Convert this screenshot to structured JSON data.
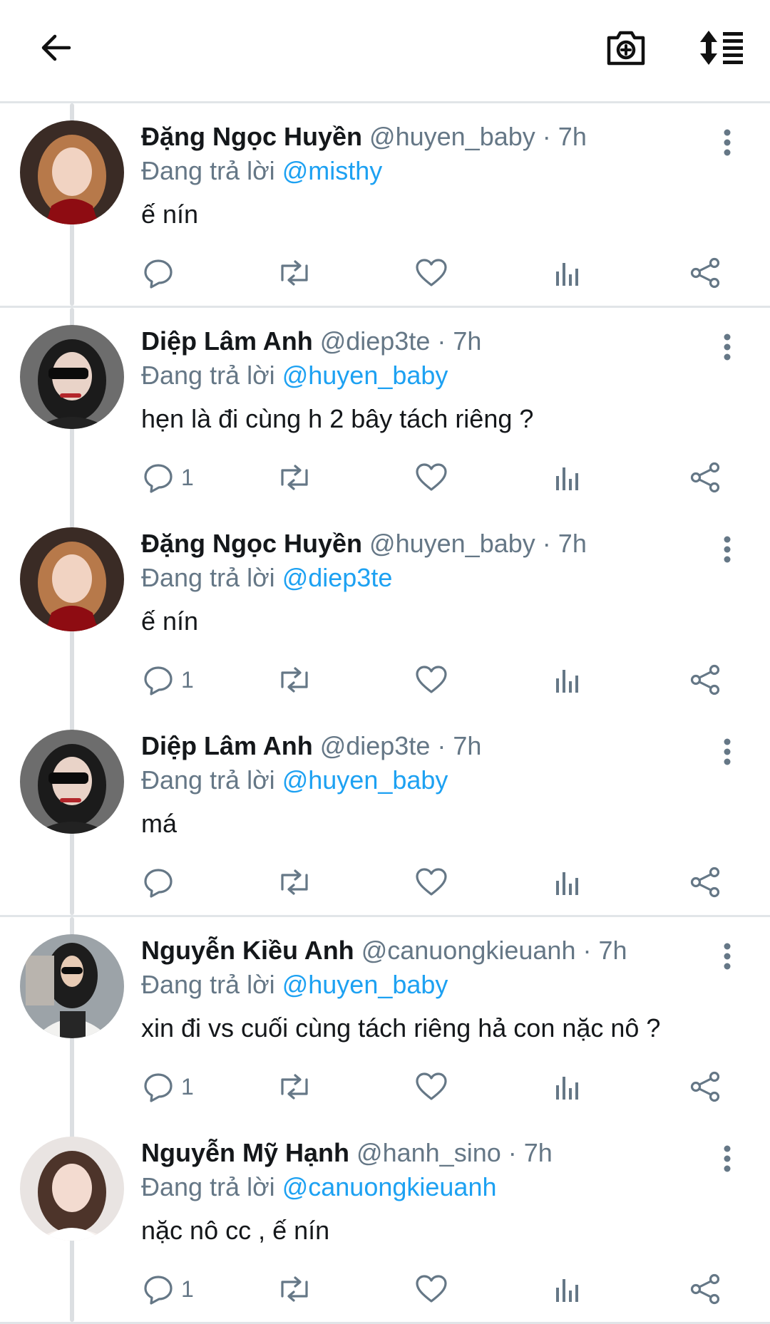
{
  "topbar": {
    "back_icon": "arrow-left-icon",
    "camera_icon": "camera-add-icon",
    "sort_icon": "sort-list-icon"
  },
  "colors": {
    "mention": "#1da1f2",
    "secondary_text": "#657786",
    "primary_text": "#14171a",
    "divider": "#e1e5e8",
    "thread_line": "#dcdfe2"
  },
  "reply_prefix": "Đang trả lời",
  "groups": [
    {
      "tweets": [
        {
          "name": "Đặng Ngọc Huyền",
          "handle": "@huyen_baby",
          "sep": "·",
          "time": "7h",
          "reply_to": "@misthy",
          "text": "ế nín",
          "reply_count": "",
          "avatar": "red-dress-woman"
        }
      ]
    },
    {
      "tweets": [
        {
          "name": "Diệp Lâm Anh",
          "handle": "@diep3te",
          "sep": "·",
          "time": "7h",
          "reply_to": "@huyen_baby",
          "text": "hẹn là đi cùng h 2 bây tách riêng ?",
          "reply_count": "1",
          "avatar": "sunglasses-woman"
        },
        {
          "name": "Đặng Ngọc Huyền",
          "handle": "@huyen_baby",
          "sep": "·",
          "time": "7h",
          "reply_to": "@diep3te",
          "text": "ế nín",
          "reply_count": "1",
          "avatar": "red-dress-woman"
        },
        {
          "name": "Diệp Lâm Anh",
          "handle": "@diep3te",
          "sep": "·",
          "time": "7h",
          "reply_to": "@huyen_baby",
          "text": "má",
          "reply_count": "",
          "avatar": "sunglasses-woman"
        }
      ]
    },
    {
      "tweets": [
        {
          "name": "Nguyễn Kiều Anh",
          "handle": "@canuongkieuanh",
          "sep": "·",
          "time": "7h",
          "reply_to": "@huyen_baby",
          "text": "xin đi vs cuối cùng tách riêng hả con nặc nô ?",
          "reply_count": "1",
          "avatar": "street-woman"
        },
        {
          "name": "Nguyễn Mỹ Hạnh",
          "handle": "@hanh_sino",
          "sep": "·",
          "time": "7h",
          "reply_to": "@canuongkieuanh",
          "text": "nặc nô cc , ế nín",
          "reply_count": "1",
          "avatar": "long-hair-woman"
        }
      ]
    }
  ]
}
